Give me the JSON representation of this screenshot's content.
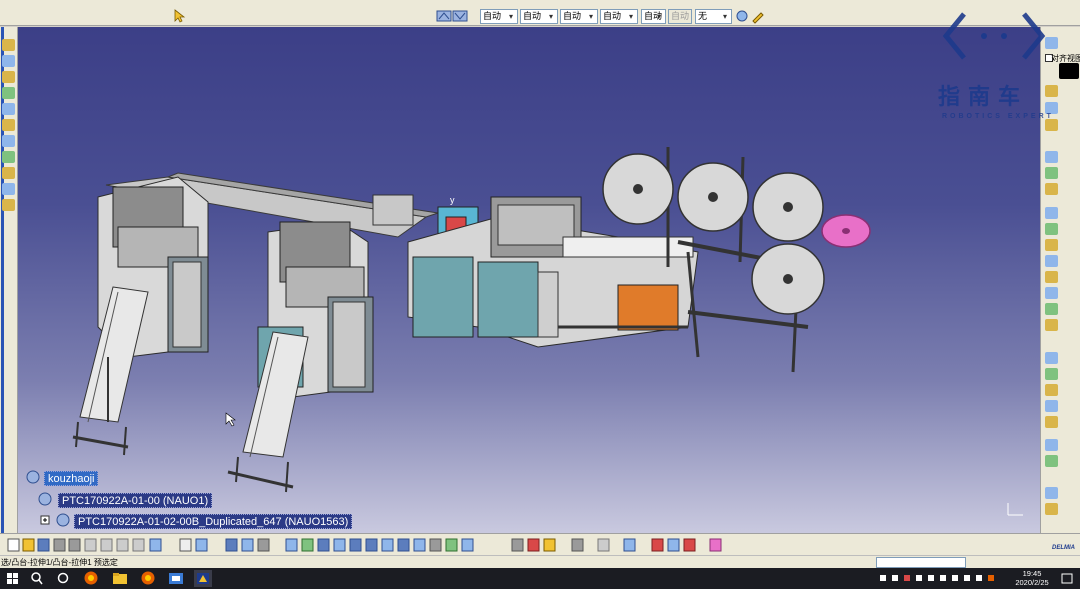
{
  "combos": [
    {
      "value": "自动"
    },
    {
      "value": "自动"
    },
    {
      "value": "自动"
    },
    {
      "value": "自动"
    },
    {
      "value": "自动"
    },
    {
      "value": "自动"
    },
    {
      "value": "无"
    }
  ],
  "right_panel": {
    "align_view_label": "对齐视图"
  },
  "tree": {
    "root": "kouzhaoji",
    "child1": "PTC170922A-01-00 (NAUO1)",
    "child2": "PTC170922A-01-02-00B_Duplicated_647 (NAUO1563)"
  },
  "status_text": "选/凸台-拉伸1/凸台-拉伸1 预选定",
  "clock": {
    "time": "19:45",
    "date": "2020/2/25"
  },
  "watermark": {
    "title": "指南车",
    "subtitle": "ROBOTICS EXPERT"
  },
  "brand": "DELMIA",
  "colors": {
    "viewport_top": "#3c3f87",
    "viewport_bottom": "#c9c9df",
    "cabinet": "#6fa5ad",
    "orange_box": "#e07b2a",
    "pink_reel": "#e870c8",
    "taskbar": "#1b1c22"
  }
}
